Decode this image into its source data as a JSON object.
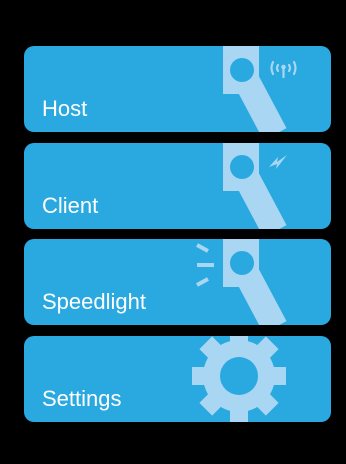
{
  "menu": {
    "items": [
      {
        "label": "Host",
        "icon": "flash-transmit-icon"
      },
      {
        "label": "Client",
        "icon": "flash-receive-icon"
      },
      {
        "label": "Speedlight",
        "icon": "speedlight-icon"
      },
      {
        "label": "Settings",
        "icon": "gear-icon"
      }
    ]
  },
  "colors": {
    "background": "#000000",
    "card": "#2aa8e0",
    "icon": "#a9d6f2",
    "text": "#ffffff"
  }
}
